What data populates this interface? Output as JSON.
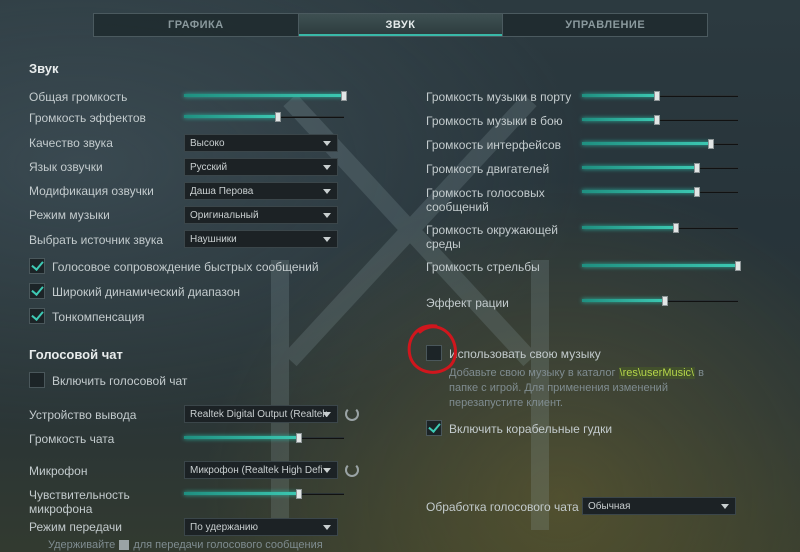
{
  "tabs": [
    {
      "label": "ГРАФИКА"
    },
    {
      "label": "ЗВУК"
    },
    {
      "label": "УПРАВЛЕНИЕ"
    }
  ],
  "sound": {
    "title": "Звук",
    "master_volume": {
      "label": "Общая громкость",
      "value": 1.0
    },
    "effects_volume": {
      "label": "Громкость эффектов",
      "value": 0.59
    },
    "quality": {
      "label": "Качество звука",
      "value": "Высоко"
    },
    "voice_language": {
      "label": "Язык озвучки",
      "value": "Русский"
    },
    "voice_mod": {
      "label": "Модификация озвучки",
      "value": "Даша Перова"
    },
    "music_mode": {
      "label": "Режим музыки",
      "value": "Оригинальный"
    },
    "sound_source": {
      "label": "Выбрать источник звука",
      "value": "Наушники"
    },
    "quick_msg": {
      "label": "Голосовое сопровождение быстрых сообщений",
      "checked": true
    },
    "dynamic_range": {
      "label": "Широкий динамический диапазон",
      "checked": true
    },
    "loudness": {
      "label": "Тонкомпенсация",
      "checked": true
    }
  },
  "right": {
    "port_music": {
      "label": "Громкость музыки в порту",
      "value": 0.48
    },
    "battle_music": {
      "label": "Громкость музыки в бою",
      "value": 0.48
    },
    "ui_volume": {
      "label": "Громкость интерфейсов",
      "value": 0.83
    },
    "engines": {
      "label": "Громкость двигателей",
      "value": 0.74
    },
    "voice_msgs": {
      "label": "Громкость голосовых сообщений",
      "value": 0.74
    },
    "ambient": {
      "label": "Громкость окружающей среды",
      "value": 0.6
    },
    "shooting": {
      "label": "Громкость стрельбы",
      "value": 1.0
    },
    "radio_effect": {
      "label": "Эффект рации",
      "value": 0.53
    },
    "own_music": {
      "label": "Использовать свою музыку",
      "checked": false
    },
    "hint_before": "Добавьте свою музыку в каталог ",
    "hint_path": "\\res\\userMusic\\",
    "hint_after": " в папке с игрой. Для применения изменений перезапустите клиент.",
    "horns": {
      "label": "Включить корабельные гудки",
      "checked": true
    },
    "voice_processing": {
      "label": "Обработка голосового чата",
      "value": "Обычная"
    }
  },
  "voice_chat": {
    "title": "Голосовой чат",
    "enable": {
      "label": "Включить голосовой чат",
      "checked": false
    },
    "output_device": {
      "label": "Устройство вывода",
      "value": "Realtek Digital Output (Realtek"
    },
    "chat_volume": {
      "label": "Громкость чата",
      "value": 0.72
    },
    "microphone": {
      "label": "Микрофон",
      "value": "Микрофон (Realtek High Defi"
    },
    "sensitivity": {
      "label": "Чувствительность микрофона",
      "value": 0.72
    },
    "transmit_mode": {
      "label": "Режим передачи",
      "value": "По удержанию"
    },
    "hold_hint_before": "Удерживайте",
    "hold_hint_after": "для передачи голосового сообщения"
  },
  "colors": {
    "accent": "#3cc8b2",
    "annotation": "#d0161d",
    "path_highlight": "#b6d64a"
  }
}
